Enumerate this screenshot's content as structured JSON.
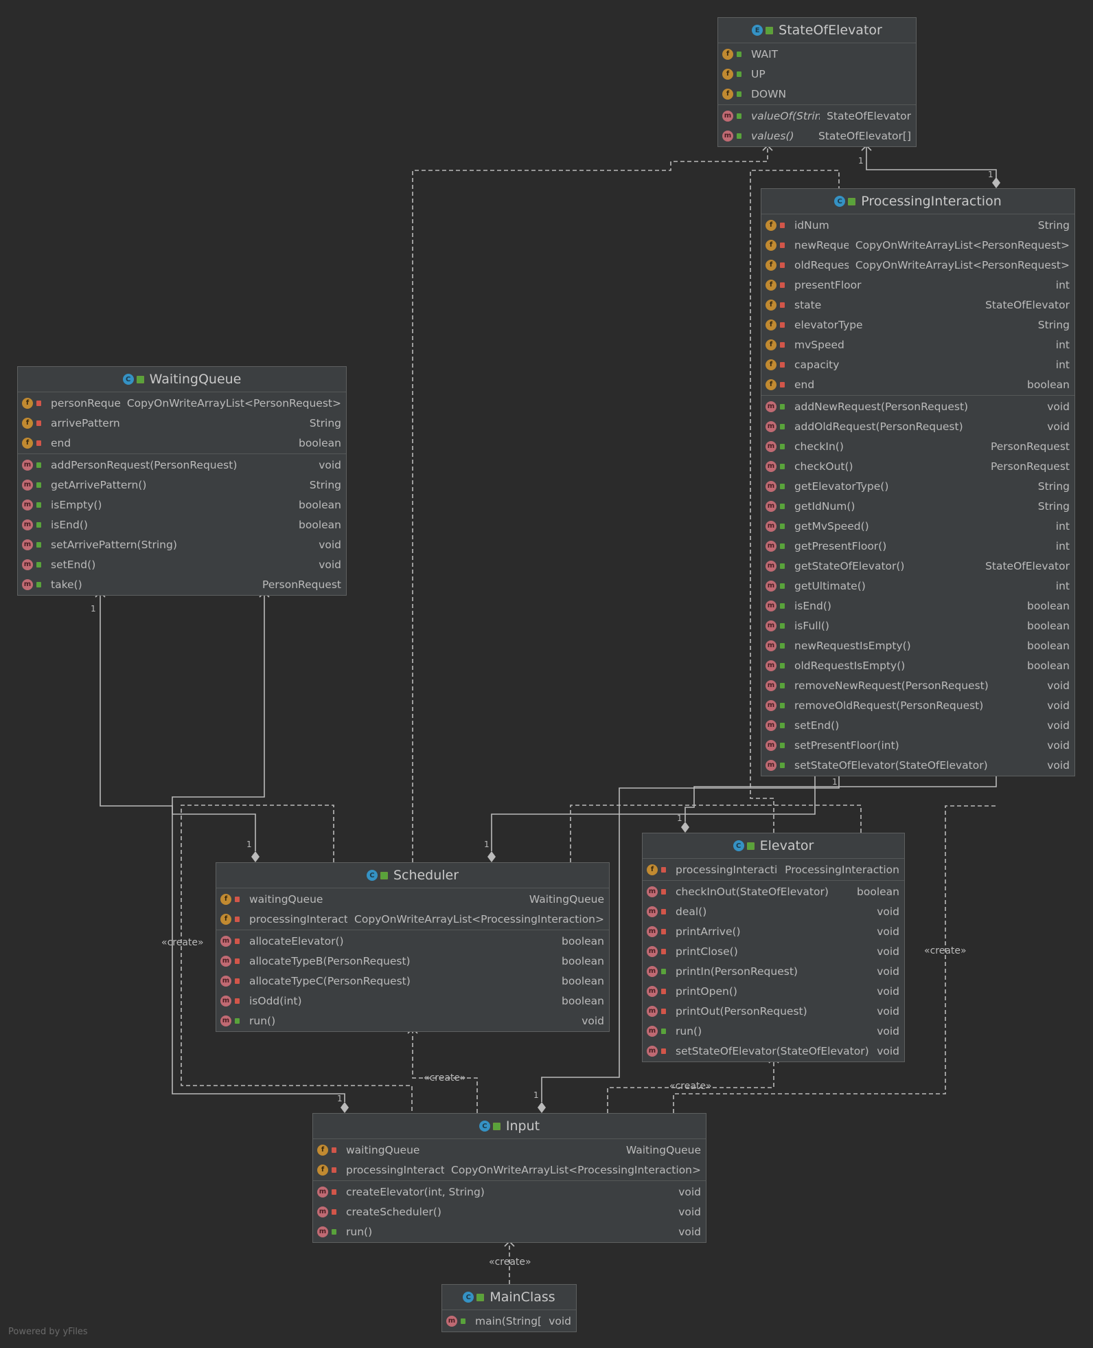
{
  "classes": {
    "stateOfElevator": {
      "name": "StateOfElevator",
      "kind": "E",
      "fields": [
        {
          "name": "WAIT",
          "type": "",
          "vis": "public"
        },
        {
          "name": "UP",
          "type": "",
          "vis": "public"
        },
        {
          "name": "DOWN",
          "type": "",
          "vis": "public"
        }
      ],
      "methods": [
        {
          "name": "valueOf(String)",
          "type": "StateOfElevator",
          "vis": "public",
          "italic": true
        },
        {
          "name": "values()",
          "type": "StateOfElevator[]",
          "vis": "public",
          "italic": true
        }
      ]
    },
    "processingInteraction": {
      "name": "ProcessingInteraction",
      "kind": "C",
      "fields": [
        {
          "name": "idNum",
          "type": "String",
          "vis": "private"
        },
        {
          "name": "newRequests",
          "type": "CopyOnWriteArrayList<PersonRequest>",
          "vis": "private"
        },
        {
          "name": "oldRequests",
          "type": "CopyOnWriteArrayList<PersonRequest>",
          "vis": "private"
        },
        {
          "name": "presentFloor",
          "type": "int",
          "vis": "private"
        },
        {
          "name": "state",
          "type": "StateOfElevator",
          "vis": "private"
        },
        {
          "name": "elevatorType",
          "type": "String",
          "vis": "private"
        },
        {
          "name": "mvSpeed",
          "type": "int",
          "vis": "private"
        },
        {
          "name": "capacity",
          "type": "int",
          "vis": "private"
        },
        {
          "name": "end",
          "type": "boolean",
          "vis": "private"
        }
      ],
      "methods": [
        {
          "name": "addNewRequest(PersonRequest)",
          "type": "void",
          "vis": "public"
        },
        {
          "name": "addOldRequest(PersonRequest)",
          "type": "void",
          "vis": "public"
        },
        {
          "name": "checkIn()",
          "type": "PersonRequest",
          "vis": "public"
        },
        {
          "name": "checkOut()",
          "type": "PersonRequest",
          "vis": "public"
        },
        {
          "name": "getElevatorType()",
          "type": "String",
          "vis": "public"
        },
        {
          "name": "getIdNum()",
          "type": "String",
          "vis": "public"
        },
        {
          "name": "getMvSpeed()",
          "type": "int",
          "vis": "public"
        },
        {
          "name": "getPresentFloor()",
          "type": "int",
          "vis": "public"
        },
        {
          "name": "getStateOfElevator()",
          "type": "StateOfElevator",
          "vis": "public"
        },
        {
          "name": "getUltimate()",
          "type": "int",
          "vis": "public"
        },
        {
          "name": "isEnd()",
          "type": "boolean",
          "vis": "public"
        },
        {
          "name": "isFull()",
          "type": "boolean",
          "vis": "public"
        },
        {
          "name": "newRequestIsEmpty()",
          "type": "boolean",
          "vis": "public"
        },
        {
          "name": "oldRequestIsEmpty()",
          "type": "boolean",
          "vis": "public"
        },
        {
          "name": "removeNewRequest(PersonRequest)",
          "type": "void",
          "vis": "public"
        },
        {
          "name": "removeOldRequest(PersonRequest)",
          "type": "void",
          "vis": "public"
        },
        {
          "name": "setEnd()",
          "type": "void",
          "vis": "public"
        },
        {
          "name": "setPresentFloor(int)",
          "type": "void",
          "vis": "public"
        },
        {
          "name": "setStateOfElevator(StateOfElevator)",
          "type": "void",
          "vis": "public"
        }
      ]
    },
    "waitingQueue": {
      "name": "WaitingQueue",
      "kind": "C",
      "fields": [
        {
          "name": "personRequests",
          "type": "CopyOnWriteArrayList<PersonRequest>",
          "vis": "private"
        },
        {
          "name": "arrivePattern",
          "type": "String",
          "vis": "private"
        },
        {
          "name": "end",
          "type": "boolean",
          "vis": "private"
        }
      ],
      "methods": [
        {
          "name": "addPersonRequest(PersonRequest)",
          "type": "void",
          "vis": "public"
        },
        {
          "name": "getArrivePattern()",
          "type": "String",
          "vis": "public"
        },
        {
          "name": "isEmpty()",
          "type": "boolean",
          "vis": "public"
        },
        {
          "name": "isEnd()",
          "type": "boolean",
          "vis": "public"
        },
        {
          "name": "setArrivePattern(String)",
          "type": "void",
          "vis": "public"
        },
        {
          "name": "setEnd()",
          "type": "void",
          "vis": "public"
        },
        {
          "name": "take()",
          "type": "PersonRequest",
          "vis": "public"
        }
      ]
    },
    "scheduler": {
      "name": "Scheduler",
      "kind": "C",
      "fields": [
        {
          "name": "waitingQueue",
          "type": "WaitingQueue",
          "vis": "private"
        },
        {
          "name": "processingInteractions",
          "type": "CopyOnWriteArrayList<ProcessingInteraction>",
          "vis": "private"
        }
      ],
      "methods": [
        {
          "name": "allocateElevator()",
          "type": "boolean",
          "vis": "private"
        },
        {
          "name": "allocateTypeB(PersonRequest)",
          "type": "boolean",
          "vis": "private"
        },
        {
          "name": "allocateTypeC(PersonRequest)",
          "type": "boolean",
          "vis": "private"
        },
        {
          "name": "isOdd(int)",
          "type": "boolean",
          "vis": "private"
        },
        {
          "name": "run()",
          "type": "void",
          "vis": "public"
        }
      ]
    },
    "elevator": {
      "name": "Elevator",
      "kind": "C",
      "fields": [
        {
          "name": "processingInteraction",
          "type": "ProcessingInteraction",
          "vis": "private"
        }
      ],
      "methods": [
        {
          "name": "checkInOut(StateOfElevator)",
          "type": "boolean",
          "vis": "private"
        },
        {
          "name": "deal()",
          "type": "void",
          "vis": "private"
        },
        {
          "name": "printArrive()",
          "type": "void",
          "vis": "private"
        },
        {
          "name": "printClose()",
          "type": "void",
          "vis": "private"
        },
        {
          "name": "printIn(PersonRequest)",
          "type": "void",
          "vis": "public"
        },
        {
          "name": "printOpen()",
          "type": "void",
          "vis": "private"
        },
        {
          "name": "printOut(PersonRequest)",
          "type": "void",
          "vis": "private"
        },
        {
          "name": "run()",
          "type": "void",
          "vis": "public"
        },
        {
          "name": "setStateOfElevator(StateOfElevator)",
          "type": "void",
          "vis": "private"
        }
      ]
    },
    "input": {
      "name": "Input",
      "kind": "C",
      "fields": [
        {
          "name": "waitingQueue",
          "type": "WaitingQueue",
          "vis": "private"
        },
        {
          "name": "processingInteractions",
          "type": "CopyOnWriteArrayList<ProcessingInteraction>",
          "vis": "private"
        }
      ],
      "methods": [
        {
          "name": "createElevator(int, String)",
          "type": "void",
          "vis": "private"
        },
        {
          "name": "createScheduler()",
          "type": "void",
          "vis": "private"
        },
        {
          "name": "run()",
          "type": "void",
          "vis": "public"
        }
      ]
    },
    "mainClass": {
      "name": "MainClass",
      "kind": "C",
      "fields": [],
      "methods": [
        {
          "name": "main(String[])",
          "type": "void",
          "vis": "public",
          "italic": false
        }
      ]
    }
  },
  "labels": {
    "create": "«create»",
    "one": "1"
  },
  "footer": "Powered by yFiles",
  "colors": {
    "background": "#2b2b2b",
    "box": "#3c3f41",
    "line": "#bbbbbb",
    "field_badge": "#c18a31",
    "method_badge": "#c06a73",
    "class_badge": "#3592c4"
  }
}
